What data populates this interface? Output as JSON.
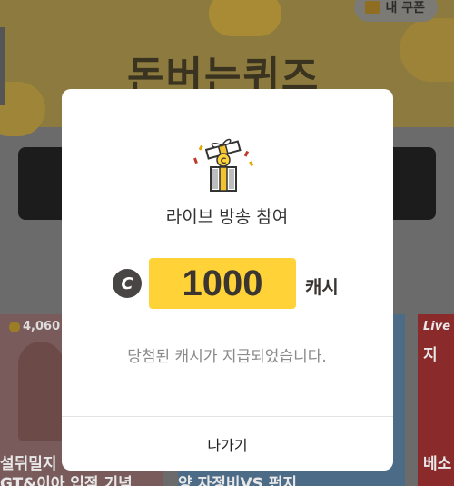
{
  "background": {
    "banner_title": "돈버는퀴즈",
    "coupon_label": "내 쿠폰",
    "cards": [
      {
        "count": "4,060",
        "line1": "설뒤밀지",
        "line2": "GT&이아 입점 기념"
      },
      {
        "line1": "",
        "line2": "양 자정비VS 펀지"
      },
      {
        "live": "Live",
        "line1": "지",
        "line2": "베소"
      }
    ]
  },
  "modal": {
    "icon": "gift-box-icon",
    "title": "라이브 방송 참여",
    "coin_symbol": "C",
    "amount": "1000",
    "unit": "캐시",
    "message": "당첨된 캐시가 지급되었습니다.",
    "exit_label": "나가기"
  },
  "colors": {
    "accent_yellow": "#ffd338",
    "coin_dark": "#4a4545",
    "message_gray": "#8a8a8a"
  }
}
